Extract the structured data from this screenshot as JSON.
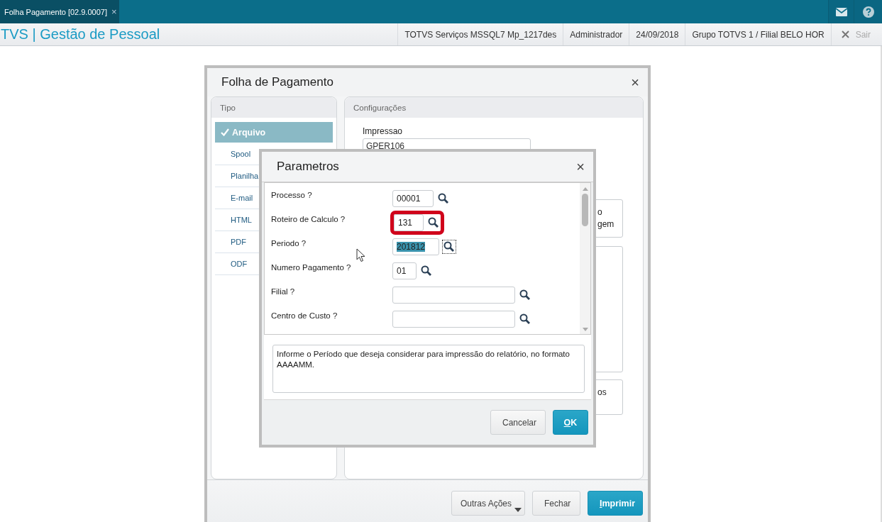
{
  "top_bar": {
    "tab": {
      "label": "Folha Pagamento [02.9.0007]",
      "close": "×"
    }
  },
  "header": {
    "title": "TVS | Gestão de Pessoal",
    "info": [
      "TOTVS Serviços MSSQL7 Mp_1217des",
      "Administrador",
      "24/09/2018",
      "Grupo TOTVS 1 / Filial BELO HOR"
    ],
    "logout": "Sair"
  },
  "dialog": {
    "title": "Folha de Pagamento",
    "close": "×",
    "tipo": {
      "title": "Tipo",
      "items": [
        {
          "label": "Arquivo",
          "selected": true
        },
        {
          "label": "Spool",
          "selected": false
        },
        {
          "label": "Planilha",
          "selected": false
        },
        {
          "label": "E-mail",
          "selected": false
        },
        {
          "label": "HTML",
          "selected": false
        },
        {
          "label": "PDF",
          "selected": false
        },
        {
          "label": "ODF",
          "selected": false
        }
      ]
    },
    "config": {
      "title": "Configurações",
      "field_label": "Impressao",
      "field_value": "GPER106",
      "boxes": [
        {
          "lines": [
            "o",
            "gem"
          ]
        },
        {
          "lines": [
            "os"
          ]
        }
      ]
    },
    "buttons": [
      {
        "label": "Outras Ações",
        "kind": "dropdown"
      },
      {
        "label": "Fechar",
        "kind": "default"
      },
      {
        "label": "Imprimir",
        "kind": "primary"
      }
    ]
  },
  "parametros": {
    "title": "Parametros",
    "close": "×",
    "rows": [
      {
        "label": "Processo ?",
        "value": "00001",
        "highlighted": false,
        "text_selected": false,
        "focused": false
      },
      {
        "label": "Roteiro de Calculo ?",
        "value": "131",
        "highlighted": true,
        "text_selected": false,
        "focused": false
      },
      {
        "label": "Periodo ?",
        "value": "201812",
        "highlighted": false,
        "text_selected": true,
        "focused": true
      },
      {
        "label": "Numero Pagamento ?",
        "value": "01",
        "highlighted": false,
        "text_selected": false,
        "focused": false
      },
      {
        "label": "Filial ?",
        "value": "",
        "highlighted": false,
        "focused": false
      },
      {
        "label": "Centro de Custo ?",
        "value": "",
        "highlighted": false,
        "focused": false
      }
    ],
    "help": "Informe o Período que deseja considerar para impressão do relatório, no formato AAAAMM.",
    "buttons": [
      {
        "label": "Cancelar",
        "kind": "default"
      },
      {
        "label": "OK",
        "kind": "primary"
      }
    ]
  }
}
